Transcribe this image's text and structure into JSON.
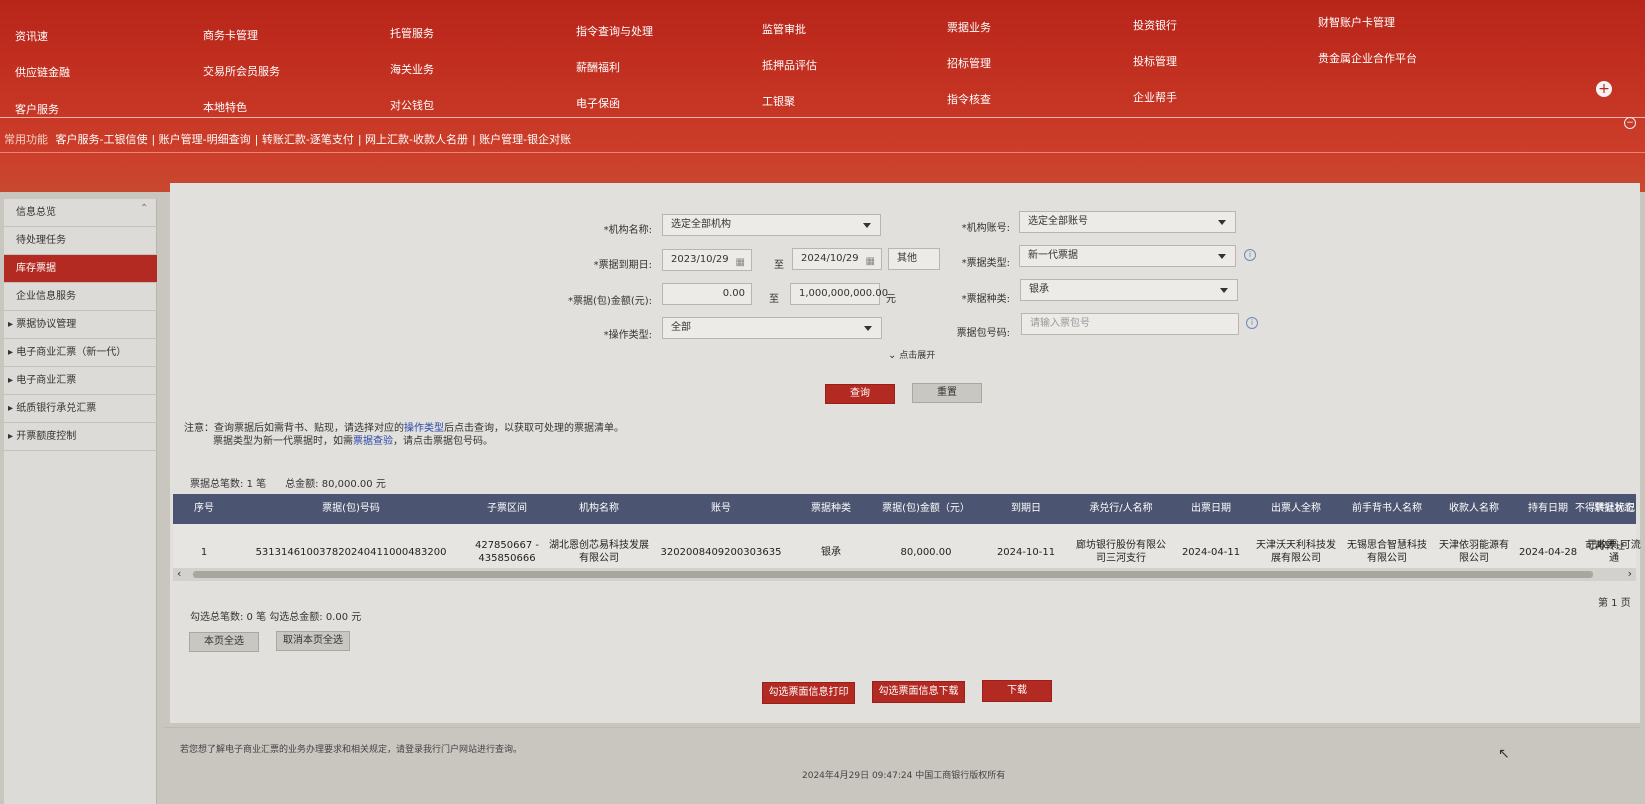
{
  "top_menu": {
    "row1": [
      "资讯速",
      "商务卡管理",
      "托管服务",
      "指令查询与处理",
      "监管审批",
      "票据业务",
      "投资银行",
      "财智账户卡管理"
    ],
    "row2": [
      "供应链金融",
      "交易所会员服务",
      "海关业务",
      "薪酬福利",
      "抵押品评估",
      "招标管理",
      "投标管理",
      "贵金属企业合作平台"
    ],
    "row3": [
      "客户服务",
      "本地特色",
      "对公钱包",
      "电子保函",
      "工银聚",
      "指令核查",
      "企业帮手"
    ]
  },
  "quick_bar": {
    "label": "常用功能",
    "items": [
      "客户服务-工银信使",
      "账户管理-明细查询",
      "转账汇款-逐笔支付",
      "网上汇款-收款人名册",
      "账户管理-银企对账"
    ]
  },
  "sidebar": {
    "items": [
      {
        "label": "信息总览"
      },
      {
        "label": "待处理任务"
      },
      {
        "label": "库存票据"
      },
      {
        "label": "企业信息服务"
      },
      {
        "label": "▸ 票据协议管理"
      },
      {
        "label": "▸ 电子商业汇票（新一代）"
      },
      {
        "label": "▸ 电子商业汇票"
      },
      {
        "label": "▸ 纸质银行承兑汇票"
      },
      {
        "label": "▸ 开票额度控制"
      }
    ]
  },
  "form": {
    "org_name_label": "*机构名称:",
    "org_name_value": "选定全部机构",
    "account_label": "*机构账号:",
    "account_value": "选定全部账号",
    "due_date_label": "*票据到期日:",
    "due_date_from": "2023/10/29",
    "to": "至",
    "due_date_to": "2024/10/29",
    "other": "其他",
    "bill_type_label": "*票据类型:",
    "bill_type_value": "新一代票据",
    "amount_label": "*票据(包)金额(元):",
    "amount_from": "0.00",
    "amount_to": "1,000,000,000.00",
    "amount_unit": "元",
    "bill_kind_label": "*票据种类:",
    "bill_kind_value": "银承",
    "op_type_label": "*操作类型:",
    "op_type_value": "全部",
    "package_no_label": "票据包号码:",
    "package_no_placeholder": "请输入票包号",
    "expand": "点击展开",
    "query": "查询",
    "reset": "重置"
  },
  "note": {
    "line1_pre": "注意：查询票据后如需背书、贴现，请选择对应的",
    "line1_link": "操作类型",
    "line1_post": "后点击查询，以获取可处理的票据清单。",
    "line2_pre": "票据类型为新一代票据时，如需",
    "line2_link": "票据查验",
    "line2_post": "，请点击票据包号码。"
  },
  "summary": {
    "count_label": "票据总笔数:",
    "count": "1 笔",
    "amount_label": "总金额:",
    "amount": "80,000.00 元"
  },
  "table": {
    "headers": [
      "序号",
      "票据(包)号码",
      "子票区间",
      "机构名称",
      "账号",
      "票据种类",
      "票据(包)金额（元）",
      "到期日",
      "承兑行/人名称",
      "出票日期",
      "出票人全称",
      "前手背书人名称",
      "收款人名称",
      "持有日期",
      "票据状态",
      "不得转让标记"
    ],
    "row": {
      "seq": "1",
      "bill_no": "531314610037820240411000483200",
      "sub_range": "427850667 - 435850666",
      "org_name": "湖北恩创芯易科技发展有限公司",
      "account": "3202008409200303635",
      "kind": "银承",
      "amount": "80,000.00",
      "due_date": "2024-10-11",
      "acceptor": "廊坊银行股份有限公司三河支行",
      "issue_date": "2024-04-11",
      "drawer": "天津沃天利科技发展有限公司",
      "endorser": "无锡思合智慧科技有限公司",
      "payee": "天津依羽能源有限公司",
      "hold_date": "2024-04-28",
      "status": "已收票-可流通",
      "transfer_mark": "可再转让"
    }
  },
  "page_info": "第 1 页",
  "checked_summary": "勾选总笔数:  0 笔  勾选总金额:  0.00 元",
  "select_page": "本页全选",
  "cancel_select_page": "取消本页全选",
  "actions": {
    "print": "勾选票面信息打印",
    "download_info": "勾选票面信息下载",
    "download": "下载"
  },
  "footer": {
    "note": "若您想了解电子商业汇票的业务办理要求和相关规定，请登录我行门户网站进行查询。",
    "copyright": "2024年4月29日 09:47:24  中国工商银行版权所有"
  }
}
